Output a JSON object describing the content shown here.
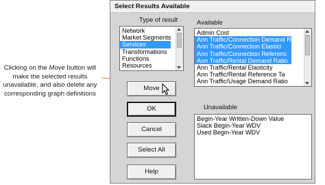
{
  "callout": {
    "lines": [
      "Clicking on the Move button will",
      "make the selected results",
      "unavailable, and also delete any",
      "corresponding graph definitions"
    ],
    "italic_word": "Move"
  },
  "dialog": {
    "title": "Select Results Available",
    "type_label": "Type of result",
    "available_label": "Available",
    "unavailable_label": "Unavailable",
    "type_list": [
      {
        "label": "Network",
        "selected": false
      },
      {
        "label": "Market Segments",
        "selected": false
      },
      {
        "label": "Services",
        "selected": true
      },
      {
        "label": "Transformations",
        "selected": false
      },
      {
        "label": "Functions",
        "selected": false
      },
      {
        "label": "Resources",
        "selected": false
      }
    ],
    "available_list": [
      {
        "label": "Admin Cost",
        "selected": false
      },
      {
        "label": "Ann Traffic/Connection Demand R",
        "selected": true
      },
      {
        "label": "Ann Traffic/Connection Elastici",
        "selected": true
      },
      {
        "label": "Ann Traffic/Connection Referenc",
        "selected": true
      },
      {
        "label": "Ann Traffic/Rental Demand Ratio",
        "selected": true
      },
      {
        "label": "Ann Traffic/Rental Elasticity",
        "selected": false
      },
      {
        "label": "Ann Traffic/Rental Reference Ta",
        "selected": false
      },
      {
        "label": "Ann Traffic/Usage Demand Ratio",
        "selected": false
      }
    ],
    "unavailable_list": [
      "Begin-Year Written-Down Value",
      "Slack Begin-Year WDV",
      "Used Begin-Year WDV"
    ],
    "buttons": {
      "move": "Move",
      "ok": "OK",
      "cancel": "Cancel",
      "select_all": "Select All",
      "help": "Help"
    }
  },
  "colors": {
    "selection": "#3399ff",
    "dialog_bg": "#d5d5d5",
    "callout_line": "#e8924f"
  }
}
